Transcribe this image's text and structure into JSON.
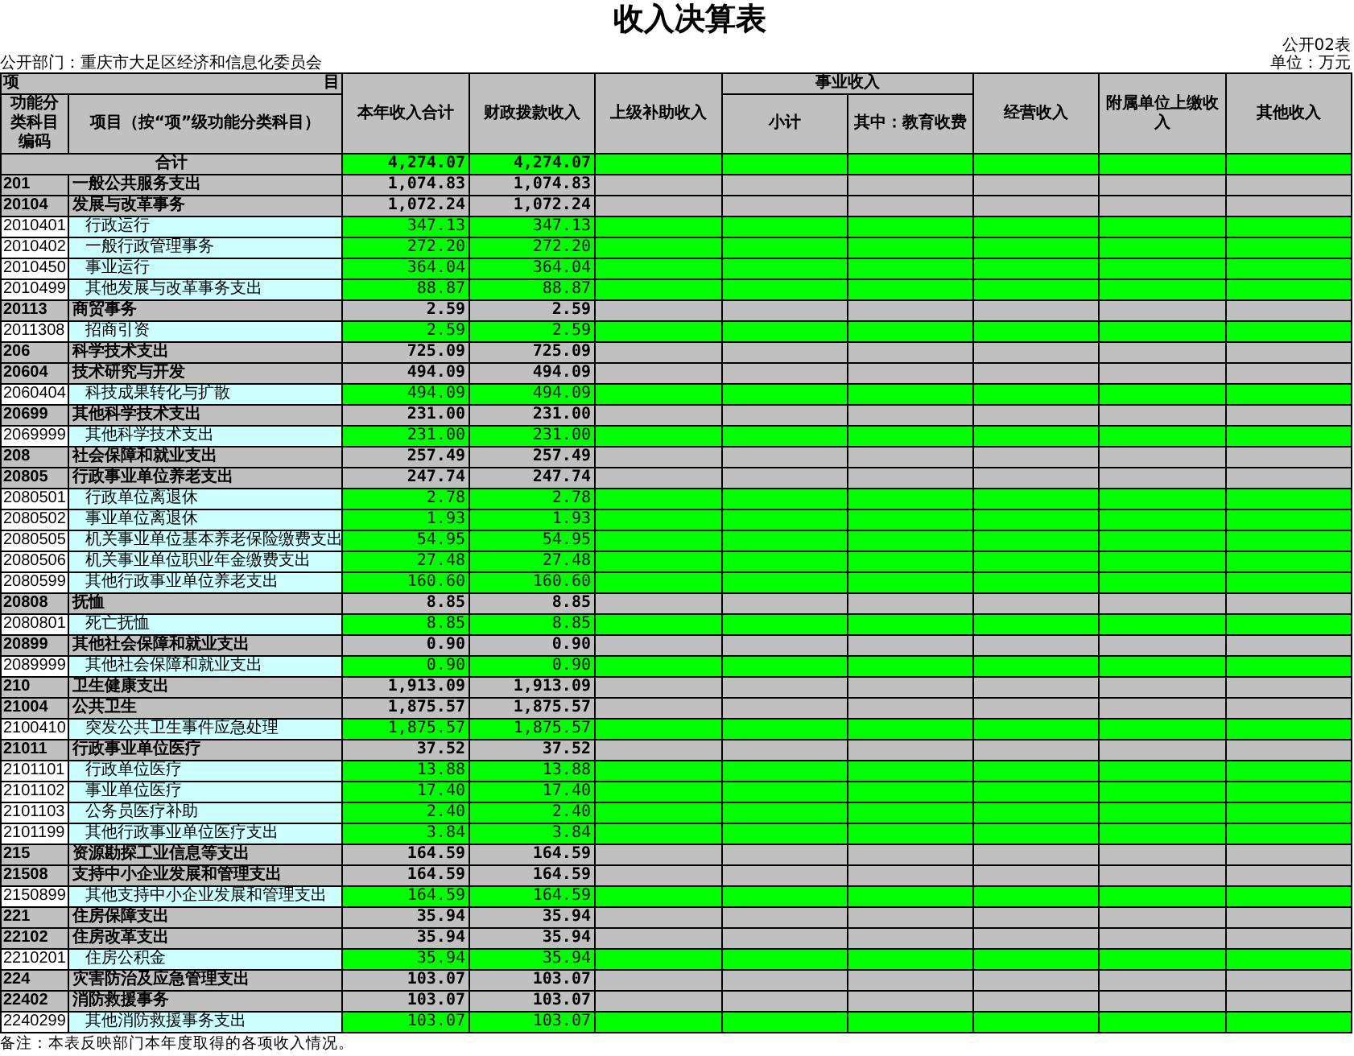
{
  "title": "收入决算表",
  "form_no": "公开02表",
  "department": "公开部门：重庆市大足区经济和信息化委员会",
  "unit": "单位：万元",
  "table": {
    "corner": {
      "left": "项",
      "right": "目"
    },
    "columns": [
      {
        "label": "功能分类科目编码"
      },
      {
        "label": "项目（按“项”级功能分类科目）"
      },
      {
        "label": "本年收入合计"
      },
      {
        "label": "财政拨款收入"
      },
      {
        "label": "上级补助收入"
      },
      {
        "label": "事业收入",
        "children": [
          {
            "label": "小计"
          },
          {
            "label": "其中：教育收费"
          }
        ]
      },
      {
        "label": "经营收入"
      },
      {
        "label": "附属单位上缴收入"
      },
      {
        "label": "其他收入"
      }
    ],
    "rows": [
      {
        "kind": "total",
        "name": "合计",
        "values": [
          "4,274.07",
          "4,274.07"
        ]
      },
      {
        "kind": "group",
        "code": "201",
        "name": "一般公共服务支出",
        "values": [
          "1,074.83",
          "1,074.83"
        ]
      },
      {
        "kind": "group",
        "code": "20104",
        "name": "发展与改革事务",
        "values": [
          "1,072.24",
          "1,072.24"
        ]
      },
      {
        "kind": "item",
        "code": "2010401",
        "name": "行政运行",
        "values": [
          "347.13",
          "347.13"
        ]
      },
      {
        "kind": "item",
        "code": "2010402",
        "name": "一般行政管理事务",
        "values": [
          "272.20",
          "272.20"
        ]
      },
      {
        "kind": "item",
        "code": "2010450",
        "name": "事业运行",
        "values": [
          "364.04",
          "364.04"
        ]
      },
      {
        "kind": "item",
        "code": "2010499",
        "name": "其他发展与改革事务支出",
        "values": [
          "88.87",
          "88.87"
        ]
      },
      {
        "kind": "group",
        "code": "20113",
        "name": "商贸事务",
        "values": [
          "2.59",
          "2.59"
        ]
      },
      {
        "kind": "item",
        "code": "2011308",
        "name": "招商引资",
        "values": [
          "2.59",
          "2.59"
        ]
      },
      {
        "kind": "group",
        "code": "206",
        "name": "科学技术支出",
        "values": [
          "725.09",
          "725.09"
        ]
      },
      {
        "kind": "group",
        "code": "20604",
        "name": "技术研究与开发",
        "values": [
          "494.09",
          "494.09"
        ]
      },
      {
        "kind": "item",
        "code": "2060404",
        "name": "科技成果转化与扩散",
        "values": [
          "494.09",
          "494.09"
        ]
      },
      {
        "kind": "group",
        "code": "20699",
        "name": "其他科学技术支出",
        "values": [
          "231.00",
          "231.00"
        ]
      },
      {
        "kind": "item",
        "code": "2069999",
        "name": "其他科学技术支出",
        "values": [
          "231.00",
          "231.00"
        ]
      },
      {
        "kind": "group",
        "code": "208",
        "name": "社会保障和就业支出",
        "values": [
          "257.49",
          "257.49"
        ]
      },
      {
        "kind": "group",
        "code": "20805",
        "name": "行政事业单位养老支出",
        "values": [
          "247.74",
          "247.74"
        ]
      },
      {
        "kind": "item",
        "code": "2080501",
        "name": "行政单位离退休",
        "values": [
          "2.78",
          "2.78"
        ]
      },
      {
        "kind": "item",
        "code": "2080502",
        "name": "事业单位离退休",
        "values": [
          "1.93",
          "1.93"
        ]
      },
      {
        "kind": "item",
        "code": "2080505",
        "name": "机关事业单位基本养老保险缴费支出",
        "values": [
          "54.95",
          "54.95"
        ]
      },
      {
        "kind": "item",
        "code": "2080506",
        "name": "机关事业单位职业年金缴费支出",
        "values": [
          "27.48",
          "27.48"
        ]
      },
      {
        "kind": "item",
        "code": "2080599",
        "name": "其他行政事业单位养老支出",
        "values": [
          "160.60",
          "160.60"
        ]
      },
      {
        "kind": "group",
        "code": "20808",
        "name": "抚恤",
        "values": [
          "8.85",
          "8.85"
        ]
      },
      {
        "kind": "item",
        "code": "2080801",
        "name": "死亡抚恤",
        "values": [
          "8.85",
          "8.85"
        ]
      },
      {
        "kind": "group",
        "code": "20899",
        "name": "其他社会保障和就业支出",
        "values": [
          "0.90",
          "0.90"
        ]
      },
      {
        "kind": "item",
        "code": "2089999",
        "name": "其他社会保障和就业支出",
        "values": [
          "0.90",
          "0.90"
        ]
      },
      {
        "kind": "group",
        "code": "210",
        "name": "卫生健康支出",
        "values": [
          "1,913.09",
          "1,913.09"
        ]
      },
      {
        "kind": "group",
        "code": "21004",
        "name": "公共卫生",
        "values": [
          "1,875.57",
          "1,875.57"
        ]
      },
      {
        "kind": "item",
        "code": "2100410",
        "name": "突发公共卫生事件应急处理",
        "values": [
          "1,875.57",
          "1,875.57"
        ]
      },
      {
        "kind": "group",
        "code": "21011",
        "name": "行政事业单位医疗",
        "values": [
          "37.52",
          "37.52"
        ]
      },
      {
        "kind": "item",
        "code": "2101101",
        "name": "行政单位医疗",
        "values": [
          "13.88",
          "13.88"
        ]
      },
      {
        "kind": "item",
        "code": "2101102",
        "name": "事业单位医疗",
        "values": [
          "17.40",
          "17.40"
        ]
      },
      {
        "kind": "item",
        "code": "2101103",
        "name": "公务员医疗补助",
        "values": [
          "2.40",
          "2.40"
        ]
      },
      {
        "kind": "item",
        "code": "2101199",
        "name": "其他行政事业单位医疗支出",
        "values": [
          "3.84",
          "3.84"
        ]
      },
      {
        "kind": "group",
        "code": "215",
        "name": "资源勘探工业信息等支出",
        "values": [
          "164.59",
          "164.59"
        ]
      },
      {
        "kind": "group",
        "code": "21508",
        "name": "支持中小企业发展和管理支出",
        "values": [
          "164.59",
          "164.59"
        ]
      },
      {
        "kind": "item",
        "code": "2150899",
        "name": "其他支持中小企业发展和管理支出",
        "values": [
          "164.59",
          "164.59"
        ]
      },
      {
        "kind": "group",
        "code": "221",
        "name": "住房保障支出",
        "values": [
          "35.94",
          "35.94"
        ]
      },
      {
        "kind": "group",
        "code": "22102",
        "name": "住房改革支出",
        "values": [
          "35.94",
          "35.94"
        ]
      },
      {
        "kind": "item",
        "code": "2210201",
        "name": "住房公积金",
        "values": [
          "35.94",
          "35.94"
        ]
      },
      {
        "kind": "group",
        "code": "224",
        "name": "灾害防治及应急管理支出",
        "values": [
          "103.07",
          "103.07"
        ]
      },
      {
        "kind": "group",
        "code": "22402",
        "name": "消防救援事务",
        "values": [
          "103.07",
          "103.07"
        ]
      },
      {
        "kind": "item",
        "code": "2240299",
        "name": "其他消防救援事务支出",
        "values": [
          "103.07",
          "103.07"
        ]
      }
    ]
  },
  "note": "备注：本表反映部门本年度取得的各项收入情况。"
}
